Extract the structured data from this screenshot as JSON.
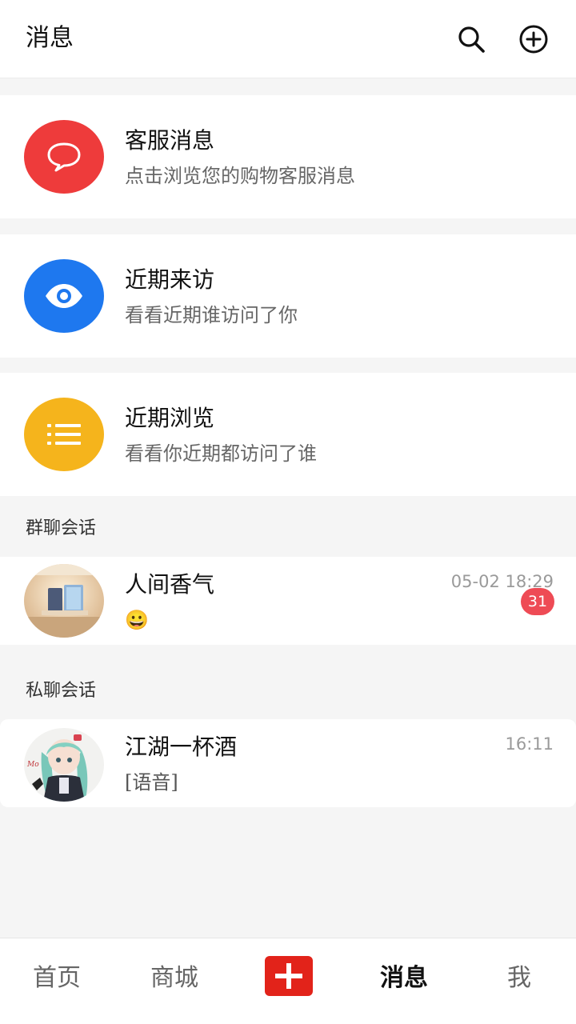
{
  "header": {
    "title": "消息",
    "search_icon": "search-icon",
    "add_icon": "add-circle-icon"
  },
  "cards": [
    {
      "title": "客服消息",
      "subtitle": "点击浏览您的购物客服消息",
      "icon": "chat-bubble-icon",
      "color": "#ee3b3b"
    },
    {
      "title": "近期来访",
      "subtitle": "看看近期谁访问了你",
      "icon": "eye-icon",
      "color": "#1e78ef"
    },
    {
      "title": "近期浏览",
      "subtitle": "看看你近期都访问了谁",
      "icon": "list-icon",
      "color": "#f5b41c"
    }
  ],
  "sections": {
    "group": "群聊会话",
    "private": "私聊会话"
  },
  "group_conversations": [
    {
      "name": "人间香气",
      "time": "05-02 18:29",
      "preview": "😀",
      "unread": "31",
      "avatar": "room-photo-avatar"
    }
  ],
  "private_conversations": [
    {
      "name": "江湖一杯酒",
      "time": "16:11",
      "preview": "[语音]",
      "avatar": "anime-girl-avatar"
    }
  ],
  "bottom_nav": {
    "items": [
      "首页",
      "商城",
      "消息",
      "我"
    ],
    "active": "消息",
    "plus_icon": "plus-icon",
    "plus_color": "#e2231a"
  }
}
